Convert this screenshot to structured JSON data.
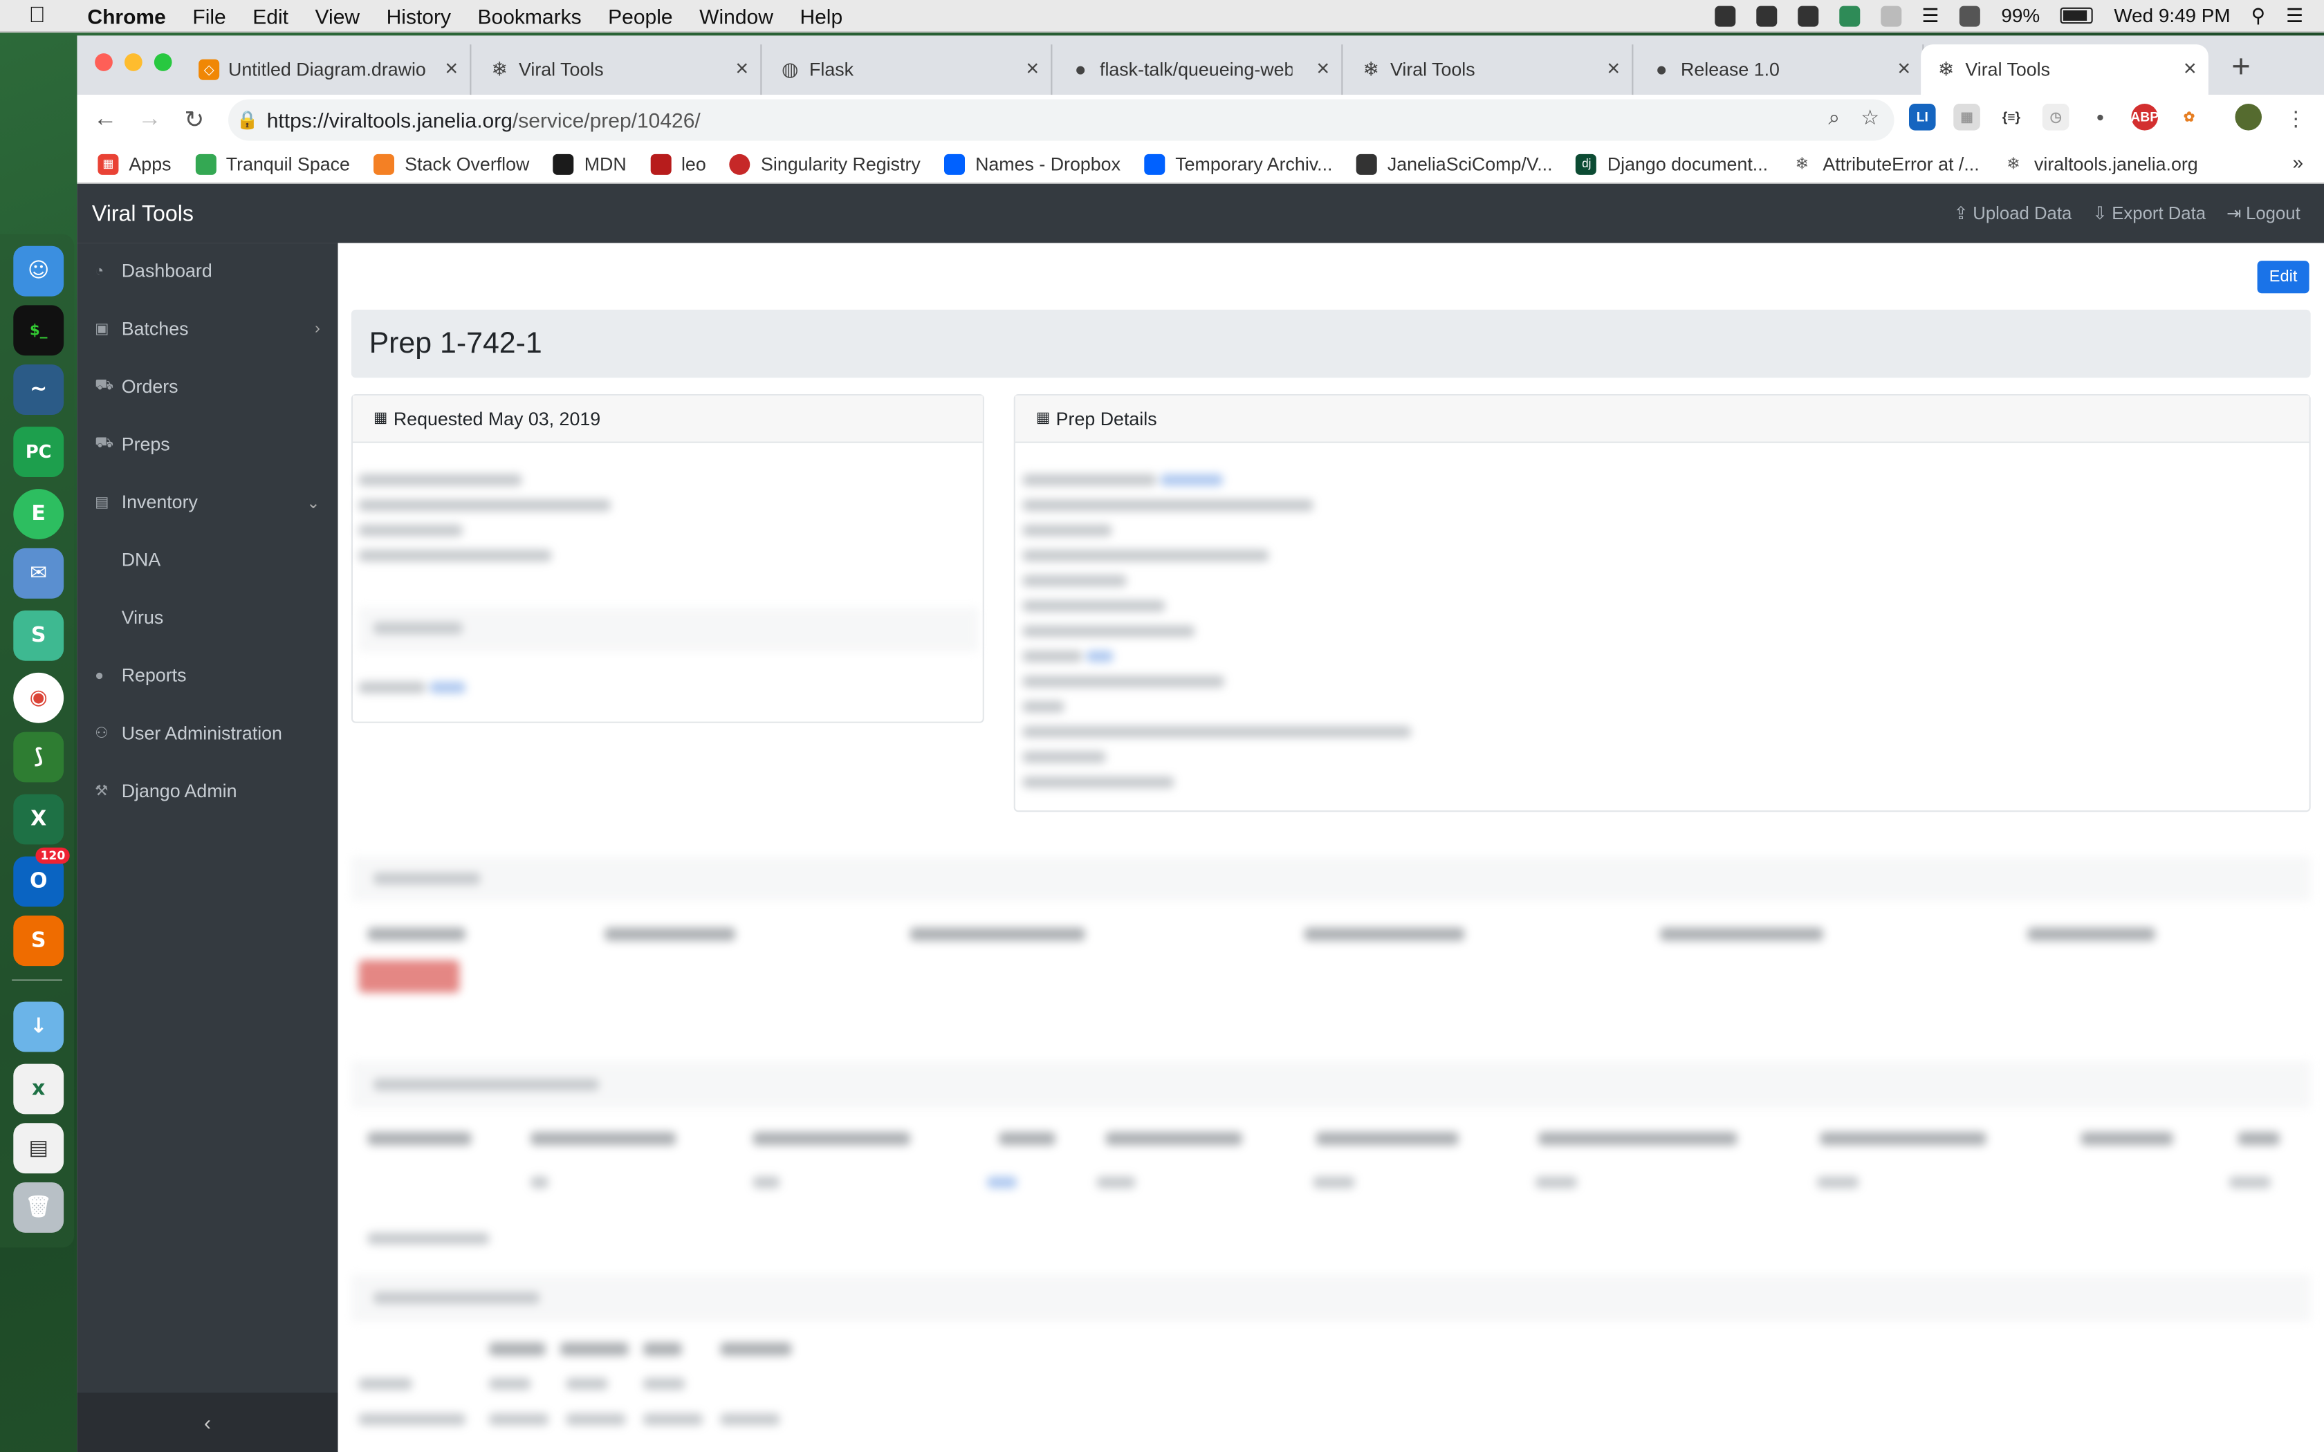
{
  "menubar": {
    "app": "Chrome",
    "items": [
      "File",
      "Edit",
      "View",
      "History",
      "Bookmarks",
      "People",
      "Window",
      "Help"
    ],
    "battery": "99%",
    "clock": "Wed 9:49 PM"
  },
  "tabs": [
    {
      "label": "Untitled Diagram.drawio",
      "icon": "drawio-icon"
    },
    {
      "label": "Viral Tools",
      "icon": "snowflake-icon"
    },
    {
      "label": "Flask",
      "icon": "globe-icon"
    },
    {
      "label": "flask-talk/queueing-web",
      "icon": "github-icon"
    },
    {
      "label": "Viral Tools",
      "icon": "snowflake-icon"
    },
    {
      "label": "Release 1.0",
      "icon": "github-icon"
    },
    {
      "label": "Viral Tools",
      "icon": "snowflake-icon"
    }
  ],
  "url": {
    "host": "https://viraltools.janelia.org",
    "path": "/service/prep/10426/"
  },
  "bookmarks": [
    {
      "label": "Apps",
      "color": "#e94235"
    },
    {
      "label": "Tranquil Space",
      "color": "#34a853"
    },
    {
      "label": "Stack Overflow",
      "color": "#f48024"
    },
    {
      "label": "MDN",
      "color": "#1b1b1b"
    },
    {
      "label": "leo",
      "color": "#b71c1c"
    },
    {
      "label": "Singularity Registry",
      "color": "#c62828"
    },
    {
      "label": "Names - Dropbox",
      "color": "#0061ff"
    },
    {
      "label": "Temporary Archiv...",
      "color": "#0061ff"
    },
    {
      "label": "JaneliaSciComp/V...",
      "color": "#333333"
    },
    {
      "label": "Django document...",
      "color": "#0c4b33"
    },
    {
      "label": "AttributeError at /...",
      "color": "#555555"
    },
    {
      "label": "viraltools.janelia.org",
      "color": "#555555"
    }
  ],
  "app": {
    "brand": "Viral Tools",
    "top_links": [
      "Upload Data",
      "Export Data",
      "Logout"
    ],
    "sidebar": [
      {
        "label": "Dashboard",
        "icon": "dashboard-icon"
      },
      {
        "label": "Batches",
        "icon": "calendar-icon",
        "chevron": "›"
      },
      {
        "label": "Orders",
        "icon": "cart-icon"
      },
      {
        "label": "Preps",
        "icon": "cart-icon"
      },
      {
        "label": "Inventory",
        "icon": "archive-icon",
        "chevron": "⌄"
      },
      {
        "label": "DNA",
        "sub": true
      },
      {
        "label": "Virus",
        "sub": true
      },
      {
        "label": "Reports",
        "icon": "comment-icon"
      },
      {
        "label": "User Administration",
        "icon": "users-icon"
      },
      {
        "label": "Django Admin",
        "icon": "wrench-icon"
      }
    ],
    "collapse": "‹",
    "edit": "Edit",
    "title": "Prep 1-742-1",
    "card_requested": "Requested May 03, 2019",
    "card_details": "Prep Details"
  },
  "colors": {
    "navbar": "#343a40",
    "primary": "#1a73e8",
    "danger": "#d9534f"
  }
}
